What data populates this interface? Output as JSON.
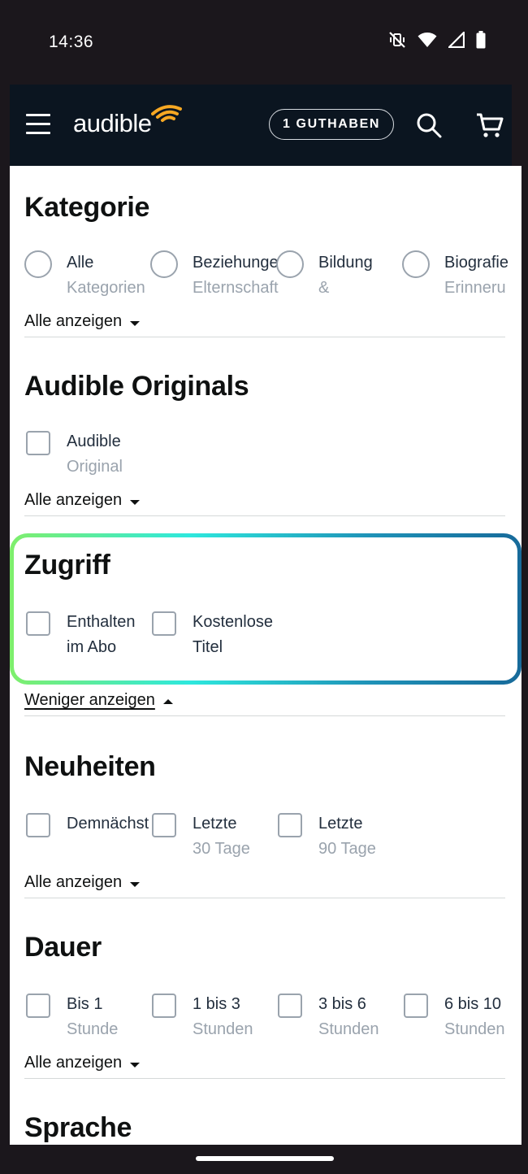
{
  "status_bar": {
    "time": "14:36"
  },
  "header": {
    "logo_text": "audible",
    "credits_label": "1 GUTHABEN"
  },
  "colors": {
    "header_bg": "#0b1520",
    "highlight_gradient": [
      "#7fef6c",
      "#2ee8dd",
      "#1f93b8",
      "#176a9a"
    ],
    "control_border": "#9aa3ad"
  },
  "sections": {
    "kategorie": {
      "title": "Kategorie",
      "options": [
        {
          "line1": "Alle",
          "line2": "Kategorien"
        },
        {
          "line1": "Beziehungen,",
          "line2": "Elternschaft"
        },
        {
          "line1": "Bildung",
          "line2": "&"
        },
        {
          "line1": "Biografie",
          "line2": "Erinneru"
        }
      ],
      "show_more": "Alle anzeigen"
    },
    "originals": {
      "title": "Audible Originals",
      "options": [
        {
          "line1": "Audible",
          "line2": "Original"
        }
      ],
      "show_more": "Alle anzeigen"
    },
    "zugriff": {
      "title": "Zugriff",
      "options": [
        {
          "line1": "Enthalten",
          "line2": "im Abo"
        },
        {
          "line1": "Kostenlose",
          "line2": "Titel"
        }
      ],
      "show_less": "Weniger anzeigen"
    },
    "neuheiten": {
      "title": "Neuheiten",
      "options": [
        {
          "line1": "Demnächst",
          "line2": ""
        },
        {
          "line1": "Letzte",
          "line2": "30 Tage"
        },
        {
          "line1": "Letzte",
          "line2": "90 Tage"
        }
      ],
      "show_more": "Alle anzeigen"
    },
    "dauer": {
      "title": "Dauer",
      "options": [
        {
          "line1": "Bis 1",
          "line2": "Stunde"
        },
        {
          "line1": "1 bis 3",
          "line2": "Stunden"
        },
        {
          "line1": "3 bis 6",
          "line2": "Stunden"
        },
        {
          "line1": "6 bis 10",
          "line2": "Stunden"
        }
      ],
      "show_more": "Alle anzeigen"
    },
    "sprache": {
      "title": "Sprache"
    }
  }
}
